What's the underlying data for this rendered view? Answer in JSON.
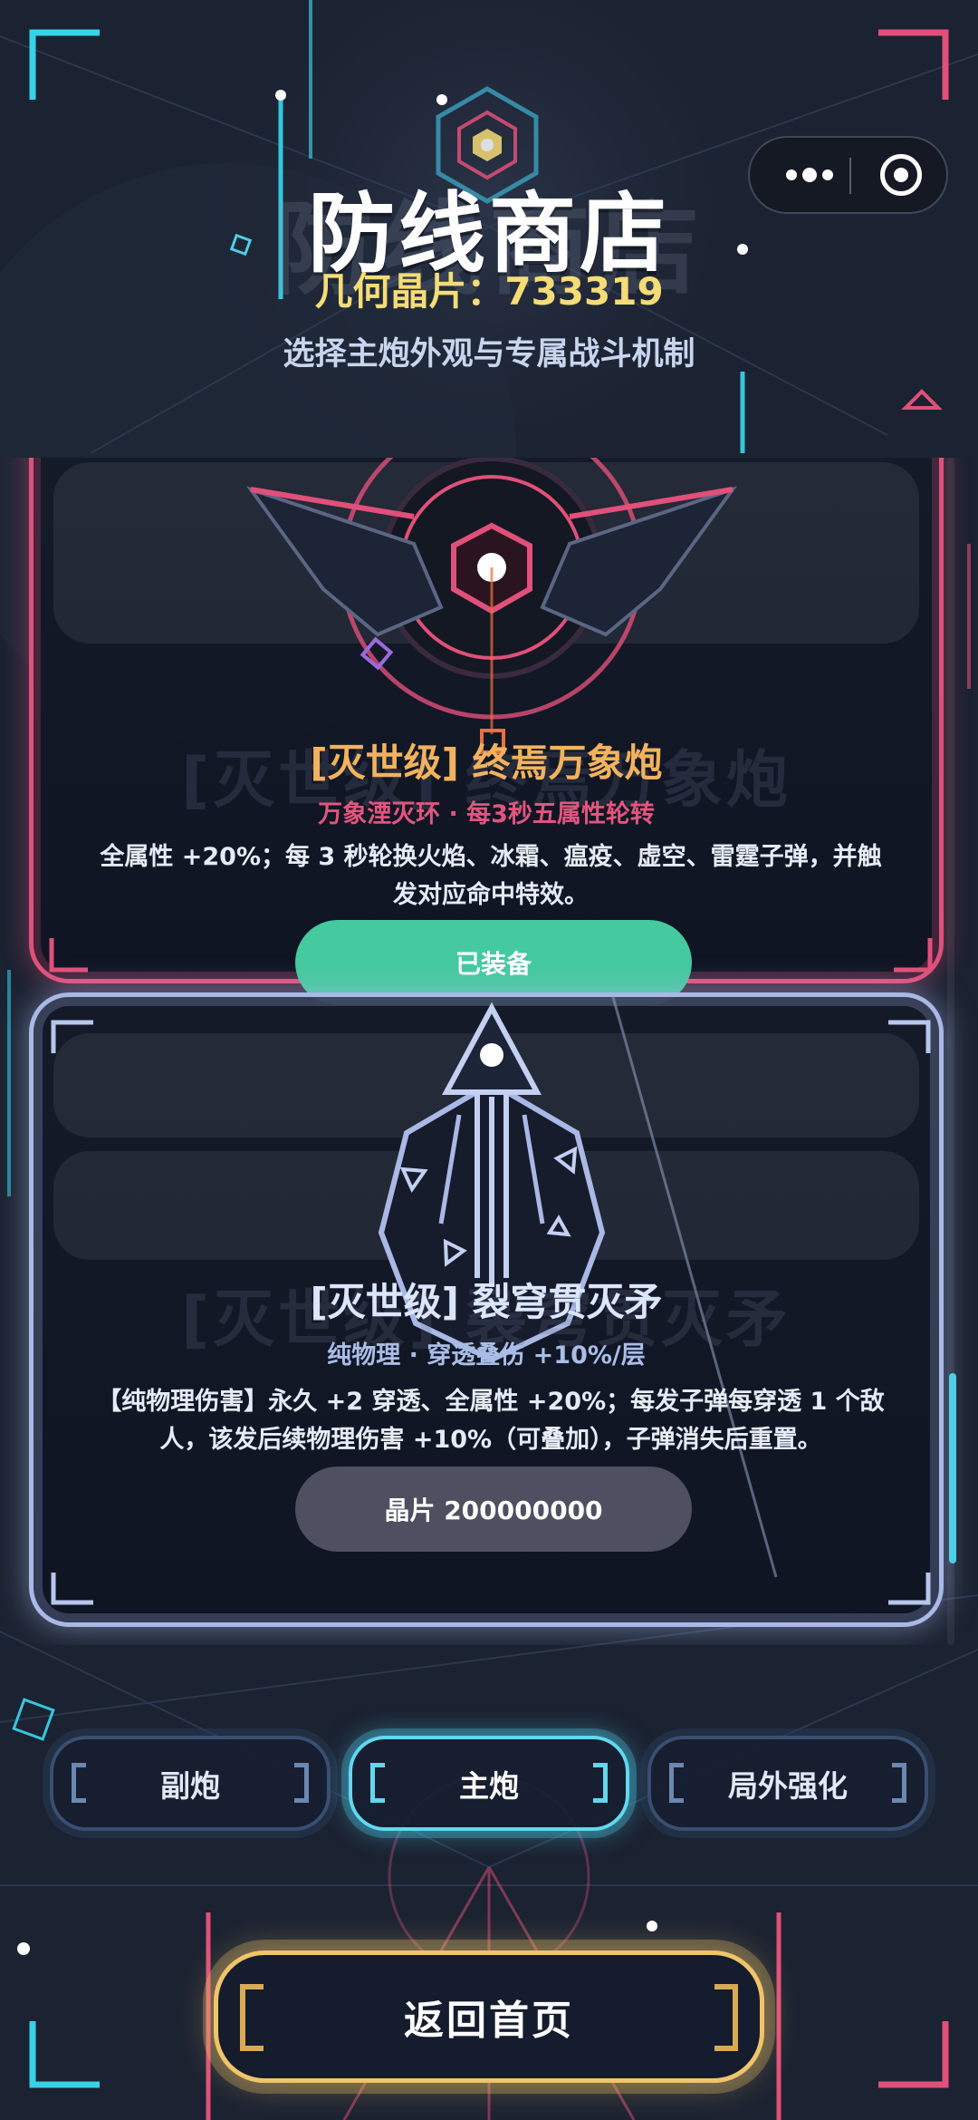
{
  "header": {
    "title": "防线商店",
    "currency_text": "几何晶片：733319",
    "subtitle": "选择主炮外观与专属战斗机制"
  },
  "capsule": {
    "more_icon": "more-dots-icon",
    "close_icon": "target-circle-icon"
  },
  "shop_items": [
    {
      "name": "[灭世级] 终焉万象炮",
      "subtitle": "万象湮灭环 · 每3秒五属性轮转",
      "description": "全属性 +20%；每 3 秒轮换火焰、冰霜、瘟疫、虚空、雷霆子弹，并触发对应命中特效。",
      "button_label": "已装备",
      "accent": "#e0507a",
      "name_color": "#f2b25e",
      "subtitle_color": "#e2557e"
    },
    {
      "name": "[灭世级] 裂穹贯灭矛",
      "subtitle": "纯物理 · 穿透叠伤 +10%/层",
      "description": "【纯物理伤害】永久 +2 穿透、全属性 +20%；每发子弹每穿透 1 个敌人，该发后续物理伤害 +10%（可叠加），子弹消失后重置。",
      "button_label": "晶片 200000000",
      "accent": "#aab8e6",
      "name_color": "#dbe5fb",
      "subtitle_color": "#a9bde6"
    }
  ],
  "tabs": [
    {
      "label": "副炮",
      "active": false
    },
    {
      "label": "主炮",
      "active": true
    },
    {
      "label": "局外强化",
      "active": false
    }
  ],
  "home_button": {
    "label": "返回首页"
  },
  "colors": {
    "background": "#1b2231",
    "gold": "#f5dc76",
    "equipped_green": "#45c99e",
    "cyan": "#4ecfe6"
  }
}
